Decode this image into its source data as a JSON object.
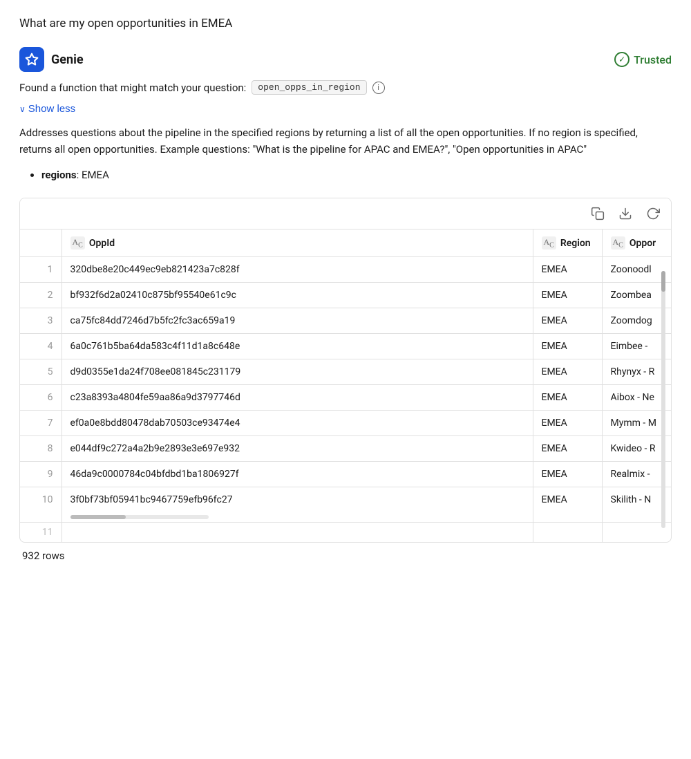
{
  "page": {
    "question": "What are my open opportunities in EMEA"
  },
  "genie": {
    "name": "Genie",
    "trusted_label": "Trusted",
    "function_text": "Found a function that might match your question:",
    "function_name": "open_opps_in_region",
    "show_less_label": "Show less",
    "description": "Addresses questions about the pipeline in the specified regions by returning a list of all the open opportunities. If no region is specified, returns all open opportunities. Example questions: \"What is the pipeline for APAC and EMEA?\", \"Open opportunities in APAC\"",
    "param_name": "regions",
    "param_value": "EMEA",
    "info_icon_label": "i"
  },
  "toolbar": {
    "copy_icon": "⧉",
    "download_icon": "↓",
    "refresh_icon": "↺"
  },
  "table": {
    "columns": [
      {
        "id": "row_num",
        "label": "",
        "type": ""
      },
      {
        "id": "opp_id",
        "label": "OppId",
        "type": "AB"
      },
      {
        "id": "region",
        "label": "Region",
        "type": "AB"
      },
      {
        "id": "opportunity",
        "label": "Oppor",
        "type": "AB"
      }
    ],
    "rows": [
      {
        "num": "1",
        "opp_id": "320dbe8e20c449ec9eb821423a7c828f",
        "region": "EMEA",
        "opportunity": "Zoonoodl"
      },
      {
        "num": "2",
        "opp_id": "bf932f6d2a02410c875bf95540e61c9c",
        "region": "EMEA",
        "opportunity": "Zoombea"
      },
      {
        "num": "3",
        "opp_id": "ca75fc84dd7246d7b5fc2fc3ac659a19",
        "region": "EMEA",
        "opportunity": "Zoomdog"
      },
      {
        "num": "4",
        "opp_id": "6a0c761b5ba64da583c4f11d1a8c648e",
        "region": "EMEA",
        "opportunity": "Eimbee -"
      },
      {
        "num": "5",
        "opp_id": "d9d0355e1da24f708ee081845c231179",
        "region": "EMEA",
        "opportunity": "Rhynyx - R"
      },
      {
        "num": "6",
        "opp_id": "c23a8393a4804fe59aa86a9d3797746d",
        "region": "EMEA",
        "opportunity": "Aibox - Ne"
      },
      {
        "num": "7",
        "opp_id": "ef0a0e8bdd80478dab70503ce93474e4",
        "region": "EMEA",
        "opportunity": "Mymm - M"
      },
      {
        "num": "8",
        "opp_id": "e044df9c272a4a2b9e2893e3e697e932",
        "region": "EMEA",
        "opportunity": "Kwideo - R"
      },
      {
        "num": "9",
        "opp_id": "46da9c0000784c04bfdbd1ba1806927f",
        "region": "EMEA",
        "opportunity": "Realmix -"
      },
      {
        "num": "10",
        "opp_id": "3f0bf73bf05941bc9467759efb96fc27",
        "region": "EMEA",
        "opportunity": "Skilith - N"
      }
    ],
    "row_count": "932 rows",
    "next_row": "11"
  }
}
